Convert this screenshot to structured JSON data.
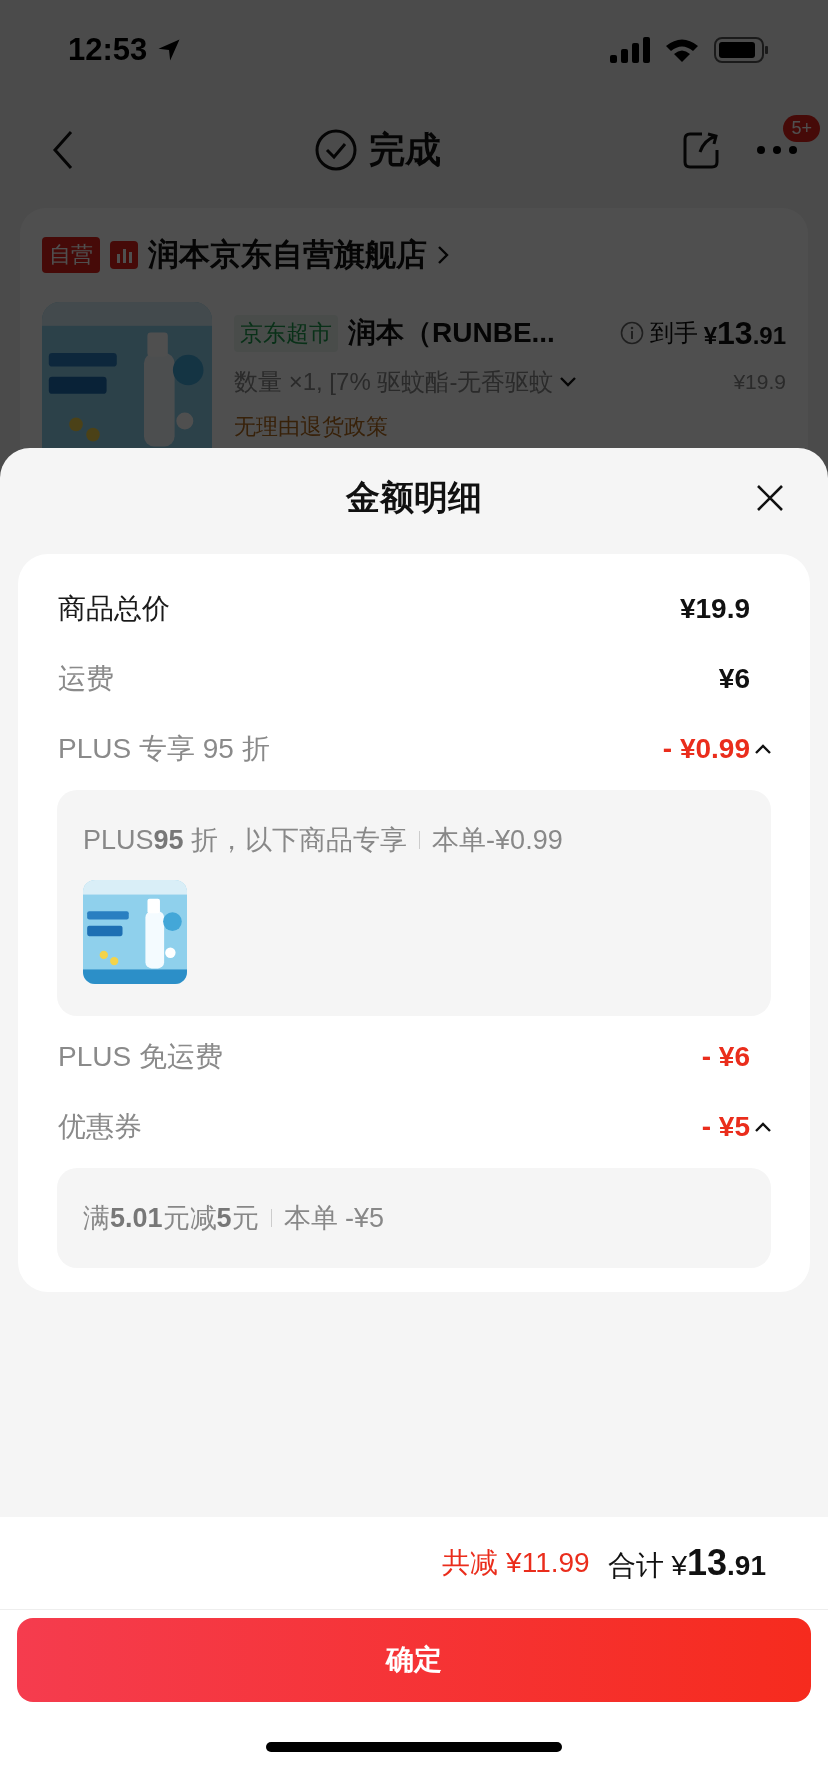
{
  "status_bar": {
    "time": "12:53"
  },
  "nav": {
    "title": "完成",
    "badge": "5+"
  },
  "store": {
    "tag": "自营",
    "name": "润本京东自营旗舰店"
  },
  "product": {
    "tag": "京东超市",
    "title": "润本（RUNBE...",
    "price_label": "到手",
    "price_symbol": "¥",
    "price_main": "13",
    "price_decimal": ".91",
    "spec": "数量 ×1, [7% 驱蚊酯-无香驱蚊",
    "original_price": "¥19.9",
    "policy": "无理由退货政策"
  },
  "sheet": {
    "title": "金额明细",
    "rows": [
      {
        "kind": "total",
        "label": "商品总价",
        "amount": "¥19.9"
      },
      {
        "kind": "plain",
        "label": "运费",
        "amount": "¥6"
      },
      {
        "kind": "discount",
        "label": "PLUS 专享 95 折",
        "amount": "- ¥0.99",
        "expanded": true,
        "detail": {
          "text": "PLUS**95** 折，以下商品专享",
          "note": "本单-¥0.99"
        }
      },
      {
        "kind": "discount",
        "label": "PLUS 免运费",
        "amount": "- ¥6"
      },
      {
        "kind": "discount",
        "label": "优惠券",
        "amount": "- ¥5",
        "expanded": true,
        "detail": {
          "text": "满**5.01**元减**5**元",
          "note": "本单 -¥5"
        }
      }
    ]
  },
  "summary": {
    "saved_label": "共减",
    "saved": "¥11.99",
    "total_label": "合计",
    "total_symbol": "¥",
    "total_main": "13",
    "total_decimal": ".91"
  },
  "confirm": "确定"
}
